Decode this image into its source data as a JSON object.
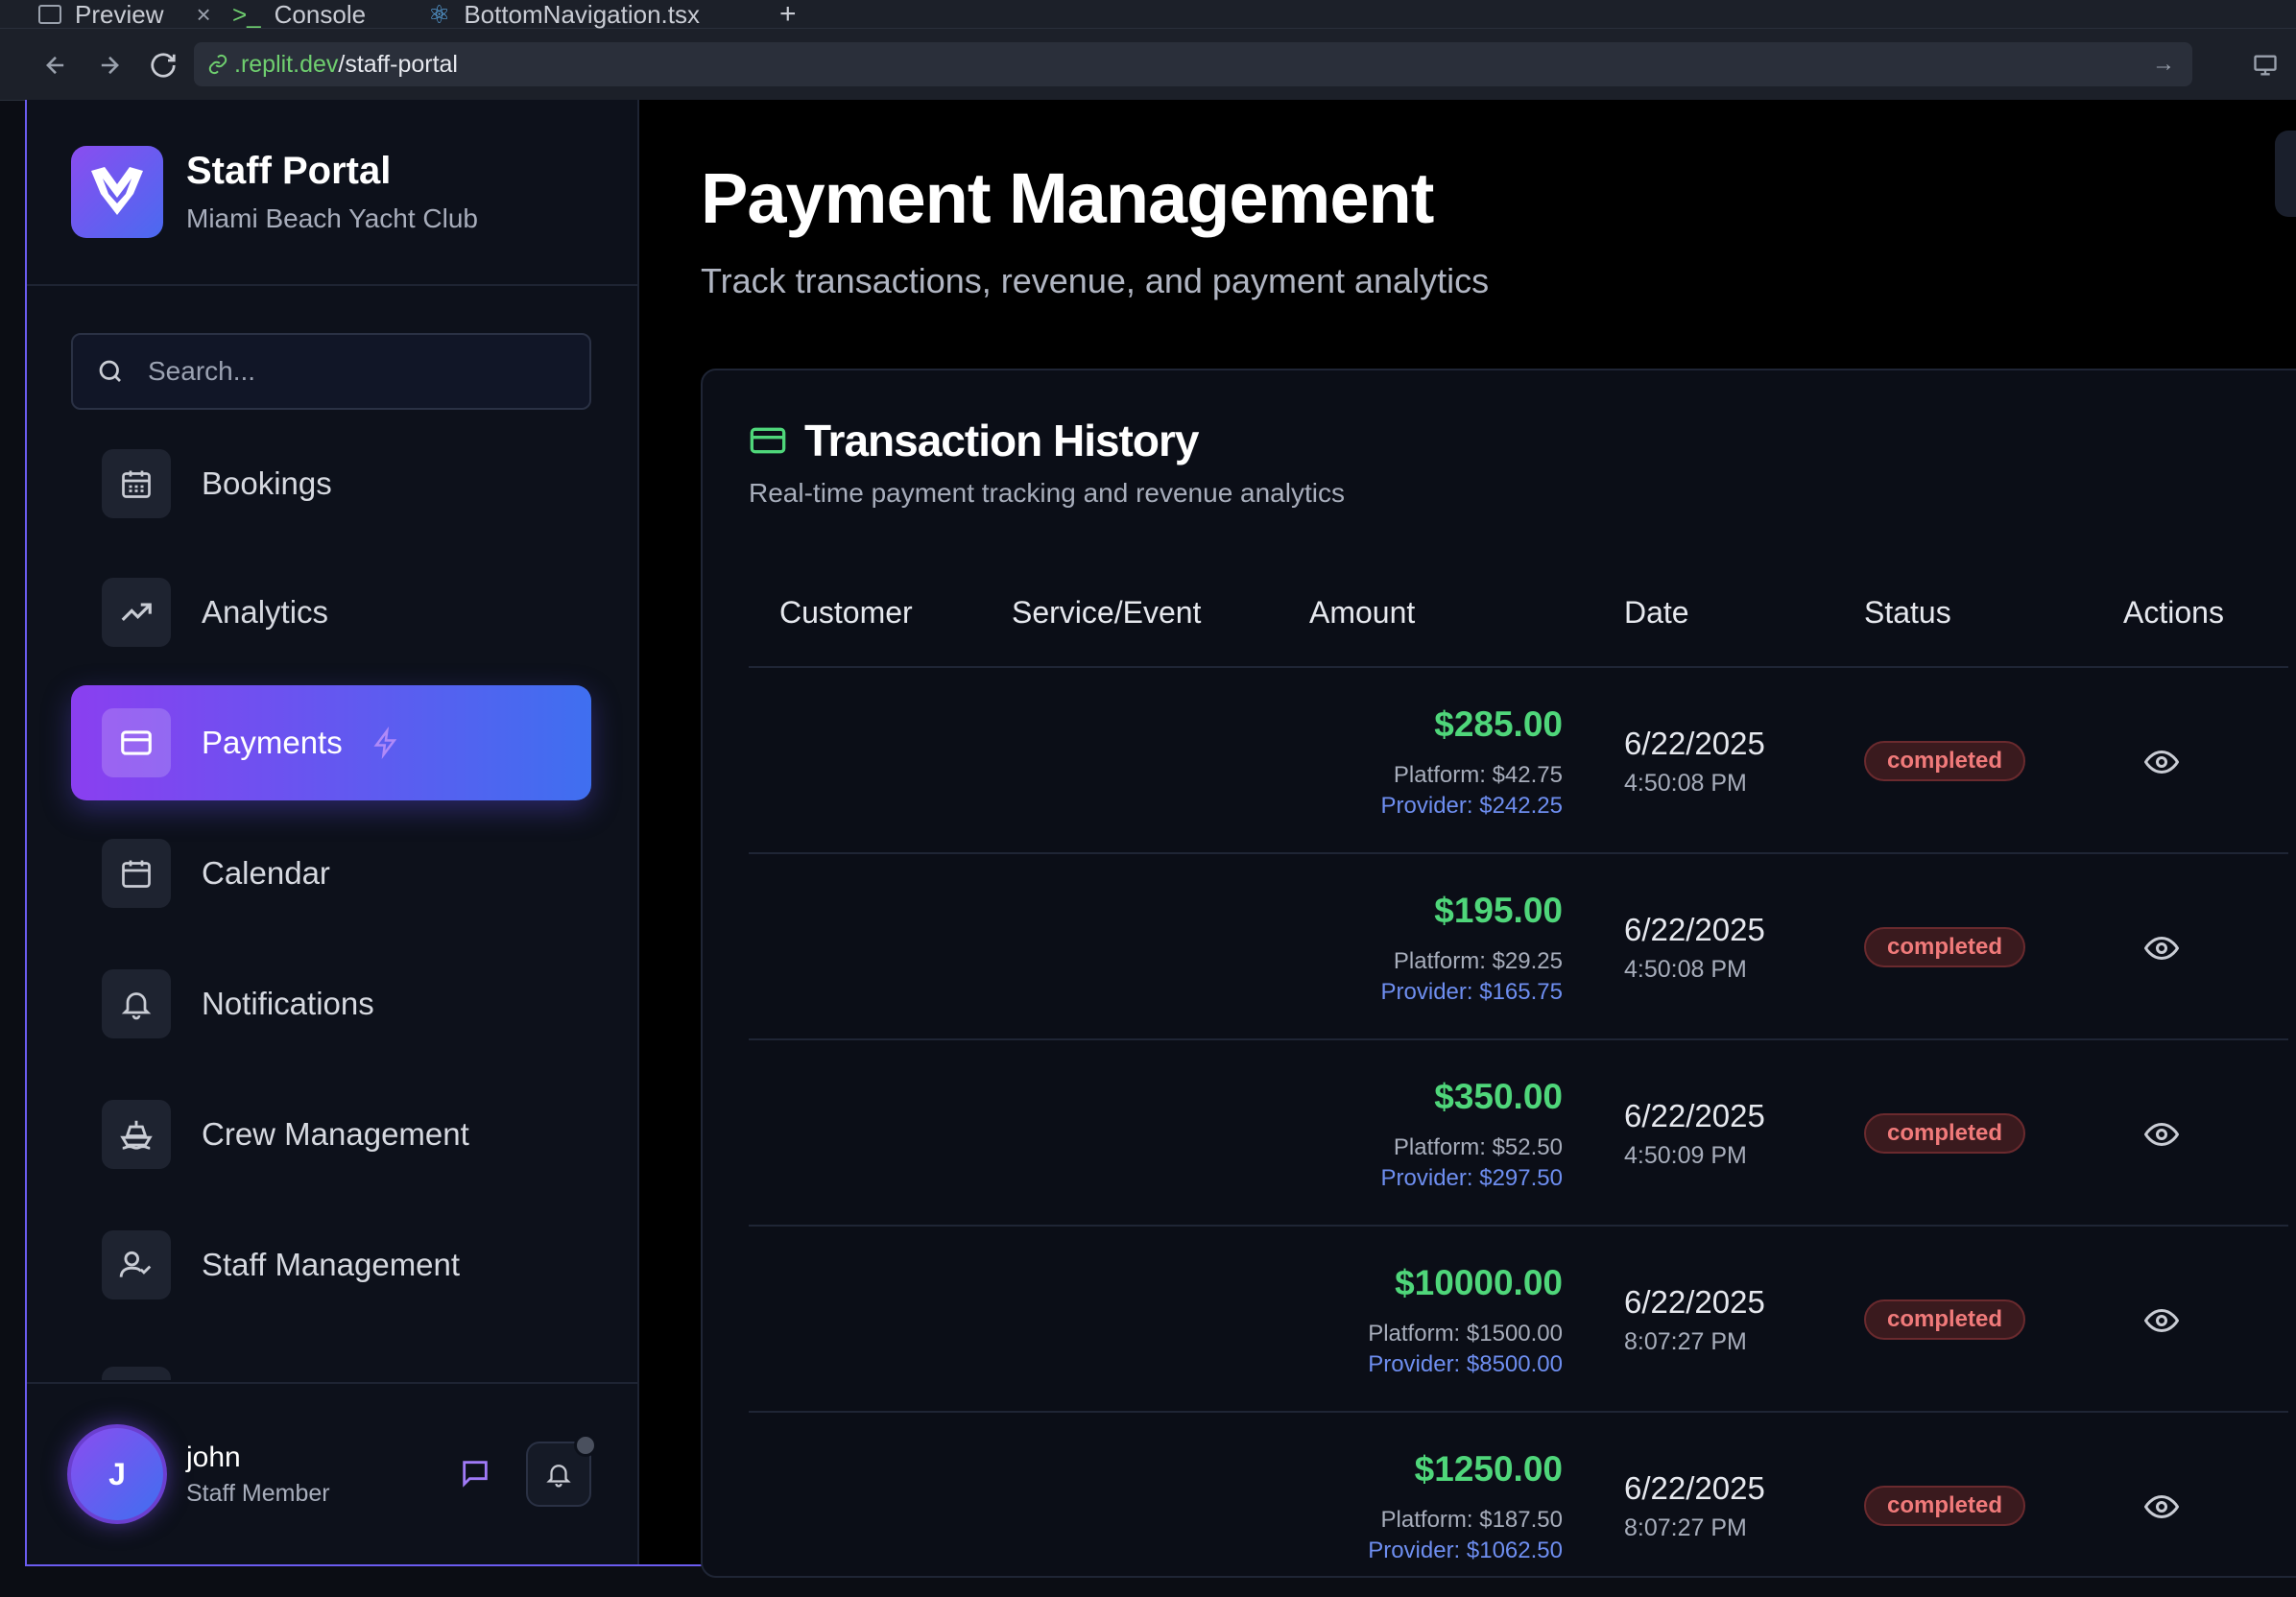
{
  "browser": {
    "tabs": [
      {
        "label": "Preview"
      },
      {
        "label": "Console"
      },
      {
        "label": "BottomNavigation.tsx"
      }
    ],
    "url_host": ".replit.dev",
    "url_path": "/staff-portal"
  },
  "sidebar": {
    "brand_title": "Staff Portal",
    "brand_subtitle": "Miami Beach Yacht Club",
    "search_placeholder": "Search...",
    "items": [
      {
        "label": "Bookings",
        "icon": "calendar-grid-icon"
      },
      {
        "label": "Analytics",
        "icon": "trending-up-icon"
      },
      {
        "label": "Payments",
        "icon": "credit-card-icon",
        "active": true
      },
      {
        "label": "Calendar",
        "icon": "calendar-icon"
      },
      {
        "label": "Notifications",
        "icon": "bell-icon"
      },
      {
        "label": "Crew Management",
        "icon": "ship-icon"
      },
      {
        "label": "Staff Management",
        "icon": "user-check-icon"
      }
    ],
    "user": {
      "initial": "J",
      "name": "john",
      "role": "Staff Member"
    }
  },
  "main": {
    "title": "Payment Management",
    "subtitle": "Track transactions, revenue, and payment analytics",
    "card": {
      "title": "Transaction History",
      "subtitle": "Real-time payment tracking and revenue analytics",
      "columns": [
        "Customer",
        "Service/Event",
        "Amount",
        "Date",
        "Status",
        "Actions"
      ],
      "rows": [
        {
          "amount": "$285.00",
          "platform": "Platform: $42.75",
          "provider": "Provider: $242.25",
          "date": "6/22/2025",
          "time": "4:50:08 PM",
          "status": "completed"
        },
        {
          "amount": "$195.00",
          "platform": "Platform: $29.25",
          "provider": "Provider: $165.75",
          "date": "6/22/2025",
          "time": "4:50:08 PM",
          "status": "completed"
        },
        {
          "amount": "$350.00",
          "platform": "Platform: $52.50",
          "provider": "Provider: $297.50",
          "date": "6/22/2025",
          "time": "4:50:09 PM",
          "status": "completed"
        },
        {
          "amount": "$10000.00",
          "platform": "Platform: $1500.00",
          "provider": "Provider: $8500.00",
          "date": "6/22/2025",
          "time": "8:07:27 PM",
          "status": "completed"
        },
        {
          "amount": "$1250.00",
          "platform": "Platform: $187.50",
          "provider": "Provider: $1062.50",
          "date": "6/22/2025",
          "time": "8:07:27 PM",
          "status": "completed"
        }
      ]
    }
  },
  "colors": {
    "accent_purple": "#8a3ff0",
    "accent_blue": "#3f6ff0",
    "amount_green": "#4fd67a",
    "provider_blue": "#6e8ef0",
    "status_red": "#f07a7a"
  }
}
